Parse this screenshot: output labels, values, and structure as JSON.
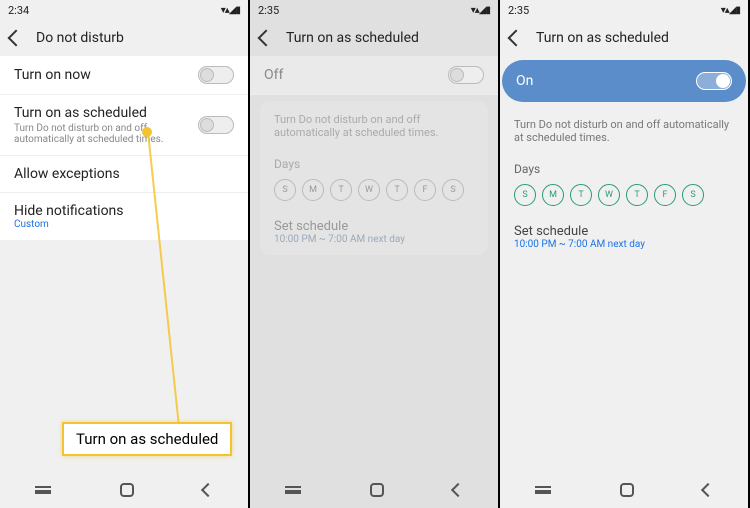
{
  "phones": [
    {
      "time": "2:34",
      "title": "Do not disturb"
    },
    {
      "time": "2:35",
      "title": "Turn on as scheduled"
    },
    {
      "time": "2:35",
      "title": "Turn on as scheduled"
    }
  ],
  "p1": {
    "turn_on_now": "Turn on now",
    "turn_on_scheduled": "Turn on as scheduled",
    "turn_on_scheduled_sub": "Turn Do not disturb on and off automatically at scheduled times.",
    "allow_exceptions": "Allow exceptions",
    "hide_notifications": "Hide notifications",
    "hide_notifications_sub": "Custom"
  },
  "p2": {
    "state": "Off",
    "desc": "Turn Do not disturb on and off automatically at scheduled times.",
    "days_label": "Days",
    "set_schedule": "Set schedule",
    "schedule_time": "10:00 PM ~ 7:00 AM next day"
  },
  "p3": {
    "state": "On",
    "desc": "Turn Do not disturb on and off automatically at scheduled times.",
    "days_label": "Days",
    "set_schedule": "Set schedule",
    "schedule_time": "10:00 PM ~ 7:00 AM next day"
  },
  "days": [
    "S",
    "M",
    "T",
    "W",
    "T",
    "F",
    "S"
  ],
  "callout": "Turn on as scheduled",
  "status_icons": "▾▴◢▮"
}
